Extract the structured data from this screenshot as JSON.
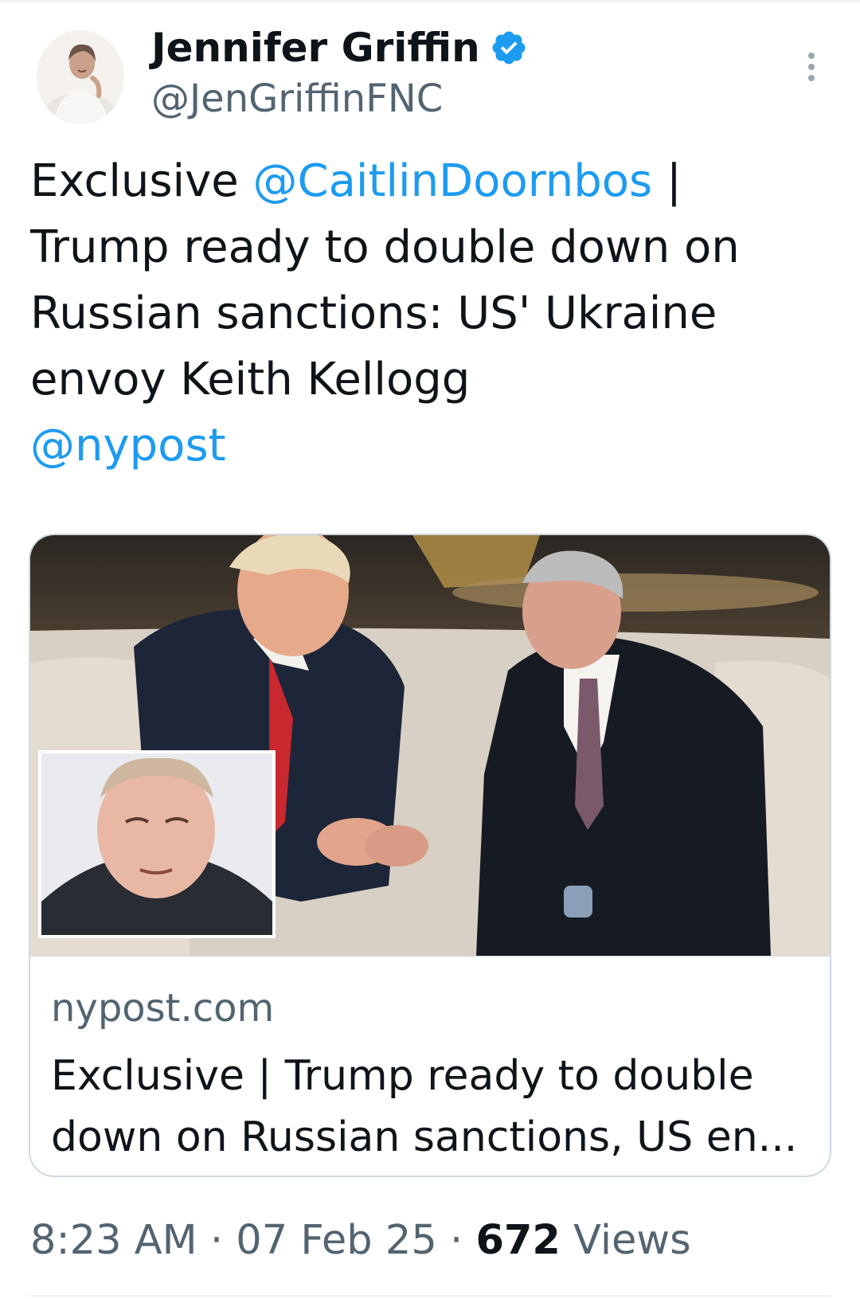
{
  "author": {
    "display_name": "Jennifer Griffin",
    "handle": "@JenGriffinFNC",
    "verified": true,
    "verified_color": "#1d9bf0",
    "avatar_icon": "profile-photo"
  },
  "tweet": {
    "lead": "Exclusive ",
    "mention_1": "@CaitlinDoornbos",
    "body": " | Trump ready to double down on Russian sanctions: US' Ukraine envoy Keith Kellogg",
    "mention_2": "@nypost"
  },
  "card": {
    "domain": "nypost.com",
    "title": "Exclusive | Trump ready to double down on Russian sanctions, US en..."
  },
  "meta": {
    "time": "8:23 AM",
    "separator": " · ",
    "date": "07 Feb 25",
    "views_count": "672",
    "views_label": " Views"
  },
  "colors": {
    "link": "#1d9bf0",
    "text": "#0f1419",
    "secondary": "#536471",
    "border": "#cfd9de"
  },
  "icons": {
    "more": "more-vertical-icon",
    "verified": "verified-badge-icon"
  }
}
